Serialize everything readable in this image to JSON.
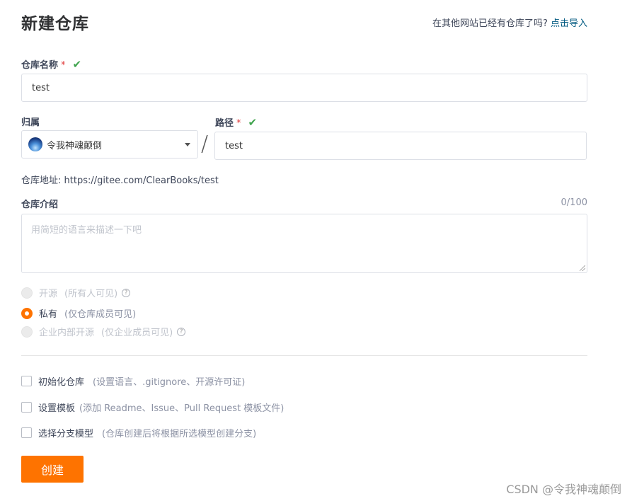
{
  "header": {
    "title": "新建仓库",
    "import_prompt": "在其他网站已经有仓库了吗?",
    "import_link": "点击导入"
  },
  "repo_name": {
    "label": "仓库名称",
    "required_mark": "*",
    "value": "test",
    "valid_icon": "check-icon"
  },
  "owner": {
    "label": "归属",
    "selected": "令我神魂颠倒"
  },
  "separator": "/",
  "path": {
    "label": "路径",
    "required_mark": "*",
    "value": "test"
  },
  "address": {
    "label": "仓库地址:",
    "url": "https://gitee.com/ClearBooks/test"
  },
  "description": {
    "label": "仓库介绍",
    "counter": "0/100",
    "placeholder": "用简短的语言来描述一下吧"
  },
  "visibility": [
    {
      "label": "开源",
      "hint": "(所有人可见)",
      "selected": false,
      "disabled": true,
      "help": true
    },
    {
      "label": "私有",
      "hint": "(仅仓库成员可见)",
      "selected": true,
      "disabled": false,
      "help": false
    },
    {
      "label": "企业内部开源",
      "hint": "(仅企业成员可见)",
      "selected": false,
      "disabled": true,
      "help": true
    }
  ],
  "options": [
    {
      "label": "初始化仓库",
      "hint": "(设置语言、.gitignore、开源许可证)",
      "checked": false
    },
    {
      "label": "设置模板",
      "hint": "(添加 Readme、Issue、Pull Request 模板文件)",
      "checked": false
    },
    {
      "label": "选择分支模型",
      "hint": "(仓库创建后将根据所选模型创建分支)",
      "checked": false
    }
  ],
  "create_button": "创建",
  "watermark": "CSDN @令我神魂颠倒",
  "colors": {
    "accent": "#fe7300",
    "link": "#005980",
    "required": "#e03a3a",
    "valid": "#3fa34d"
  }
}
